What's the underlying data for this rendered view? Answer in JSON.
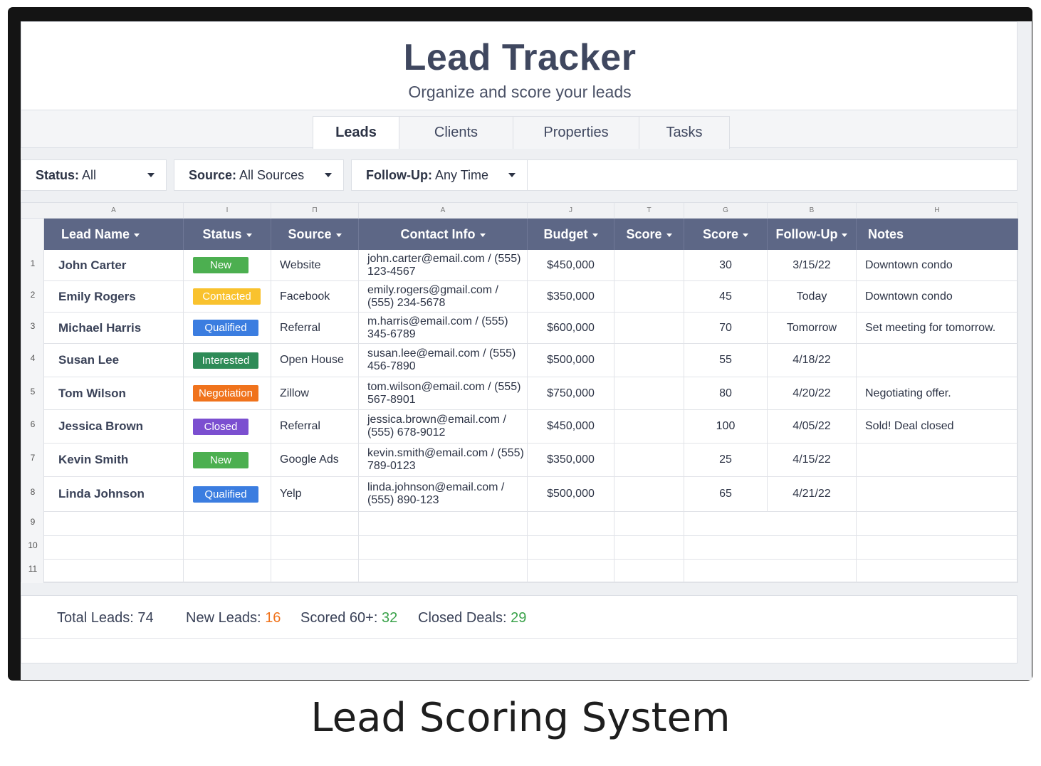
{
  "header": {
    "title": "Lead Tracker",
    "subtitle": "Organize and score your leads"
  },
  "tabs": [
    {
      "label": "Leads",
      "active": true
    },
    {
      "label": "Clients"
    },
    {
      "label": "Properties"
    },
    {
      "label": "Tasks"
    }
  ],
  "filters": [
    {
      "label": "Status:",
      "value": "All"
    },
    {
      "label": "Source:",
      "value": "All Sources"
    },
    {
      "label": "Follow-Up:",
      "value": "Any Time"
    }
  ],
  "column_letters": [
    "A",
    "I",
    "П",
    "A",
    "J",
    "T",
    "G",
    "B",
    "H"
  ],
  "columns": [
    "Lead Name",
    "Status",
    "Source",
    "Contact Info",
    "Budget",
    "Score",
    "Score",
    "Follow-Up",
    "Notes"
  ],
  "row_numbers": [
    "1",
    "2",
    "3",
    "4",
    "5",
    "6",
    "7",
    "8",
    "9",
    "10",
    "11"
  ],
  "rows": [
    {
      "name": "John Carter",
      "status": "New",
      "source": "Website",
      "contact": "john.carter@email.com / (555) 123-4567",
      "budget": "$450,000",
      "score": "30",
      "followup": "3/15/22",
      "notes": "Downtown condo"
    },
    {
      "name": "Emily Rogers",
      "status": "Contacted",
      "source": "Facebook",
      "contact": "emily.rogers@gmail.com / (555) 234-5678",
      "budget": "$350,000",
      "score": "45",
      "followup": "Today",
      "notes": "Downtown condo"
    },
    {
      "name": "Michael Harris",
      "status": "Qualified",
      "source": "Referral",
      "contact": "m.harris@email.com / (555) 345-6789",
      "budget": "$600,000",
      "score": "70",
      "followup": "Tomorrow",
      "notes": "Set meeting for tomorrow."
    },
    {
      "name": "Susan Lee",
      "status": "Interested",
      "source": "Open House",
      "contact": "susan.lee@email.com / (555) 456-7890",
      "budget": "$500,000",
      "score": "55",
      "followup": "4/18/22",
      "notes": ""
    },
    {
      "name": "Tom Wilson",
      "status": "Negotiation",
      "source": "Zillow",
      "contact": "tom.wilson@email.com / (555) 567-8901",
      "budget": "$750,000",
      "score": "80",
      "followup": "4/20/22",
      "notes": "Negotiating offer."
    },
    {
      "name": "Jessica Brown",
      "status": "Closed",
      "source": "Referral",
      "contact": "jessica.brown@email.com / (555) 678-9012",
      "budget": "$450,000",
      "score": "100",
      "followup": "4/05/22",
      "notes": "Sold! Deal closed"
    },
    {
      "name": "Kevin Smith",
      "status": "New",
      "source": "Google Ads",
      "contact": "kevin.smith@email.com / (555) 789-0123",
      "budget": "$350,000",
      "score": "25",
      "followup": "4/15/22",
      "notes": ""
    },
    {
      "name": "Linda Johnson",
      "status": "Qualified",
      "source": "Yelp",
      "contact": "linda.johnson@email.com / (555) 890-123",
      "budget": "$500,000",
      "score": "65",
      "followup": "4/21/22",
      "notes": ""
    }
  ],
  "status_colors": {
    "New": "#4caf50",
    "Contacted": "#f9c22e",
    "Qualified": "#3b7de0",
    "Interested": "#2e8b57",
    "Negotiation": "#f0731c",
    "Closed": "#7b4fd0"
  },
  "stats": {
    "total_label": "Total Leads:",
    "total_value": "74",
    "new_label": "New Leads:",
    "new_value": "16",
    "new_color": "#f0731c",
    "scored_label": "Scored 60+:",
    "scored_value": "32",
    "scored_color": "#3aa24a",
    "closed_label": "Closed Deals:",
    "closed_value": "29",
    "closed_color": "#3aa24a"
  },
  "caption": "Lead Scoring System"
}
